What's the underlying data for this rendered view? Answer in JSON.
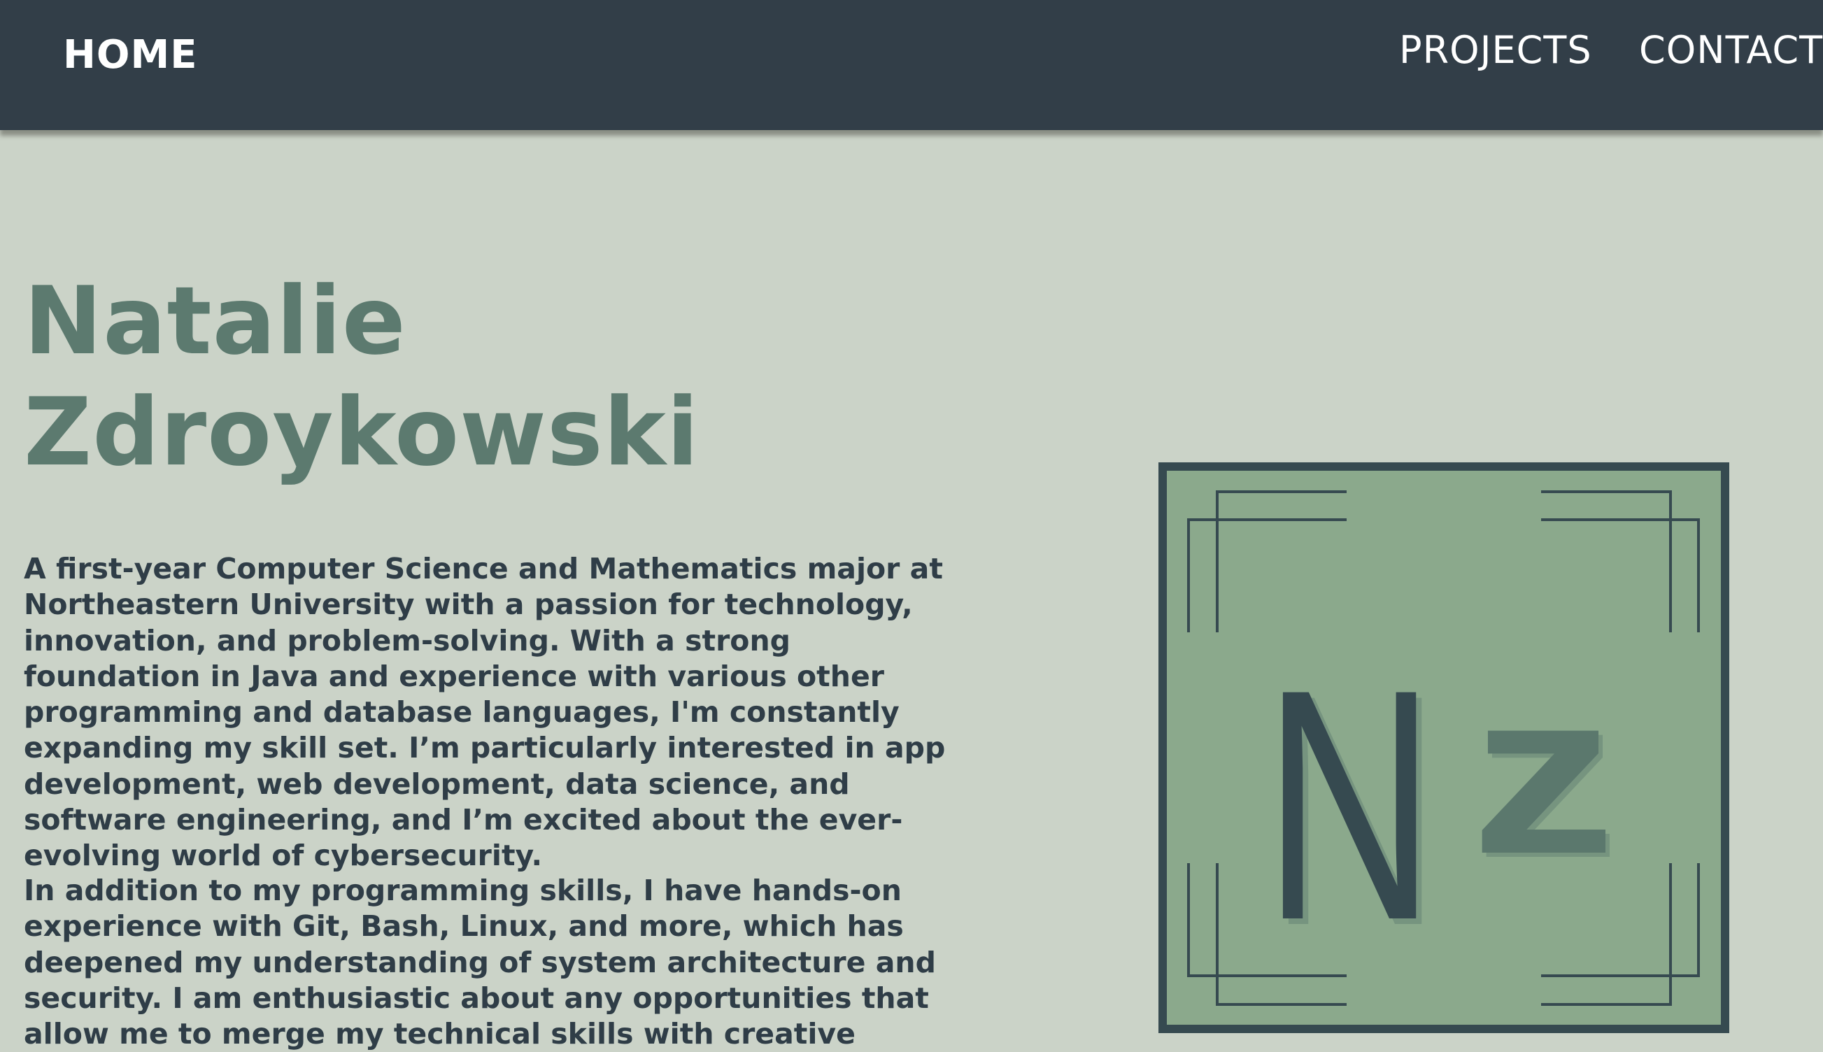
{
  "nav": {
    "home_label": "HOME",
    "projects_label": "PROJECTS",
    "contact_label": "CONTACT"
  },
  "hero": {
    "name_first": "Natalie",
    "name_last": "Zdroykowski",
    "bio_paragraphs": [
      "A first-year Computer Science and Mathematics major at Northeastern University with a passion for technology, innovation, and problem-solving. With a strong foundation in Java and experience with various other programming and database languages, I'm constantly expanding my skill set. I’m particularly interested in app development, web development, data science, and software engineering, and I’m excited about the ever-evolving world of cybersecurity.",
      "In addition to my programming skills, I have hands-on experience with Git, Bash, Linux, and more, which has deepened my understanding of system architecture and security. I am enthusiastic about any opportunities that allow me to merge my technical skills with creative"
    ]
  },
  "logo": {
    "letter_big": "N",
    "letter_small": "z"
  },
  "colors": {
    "nav_background": "#323e48",
    "page_background": "#cbd3c8",
    "name_color": "#5c7a6f",
    "text_color": "#2f3d47",
    "logo_fill": "#8ba98c",
    "logo_border": "#364a50"
  }
}
